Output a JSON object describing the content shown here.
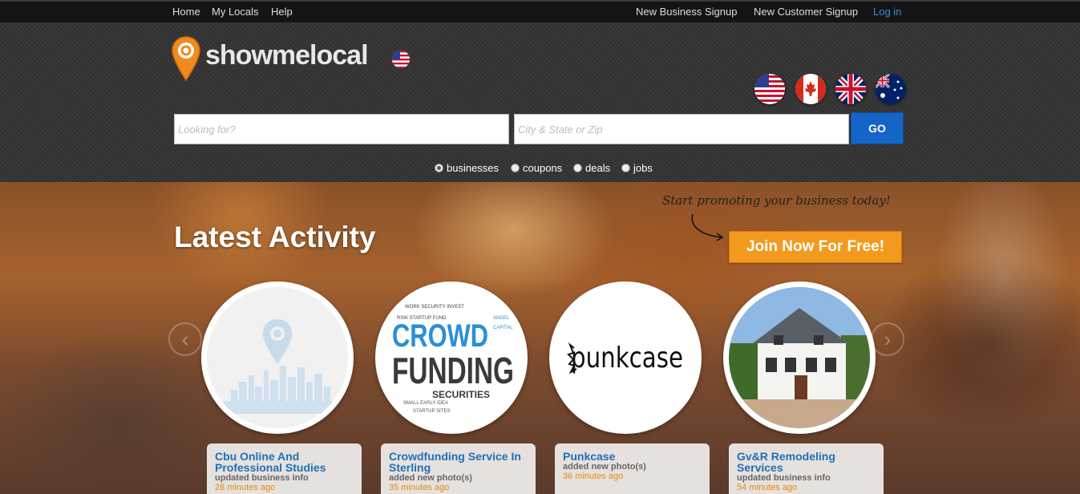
{
  "topnav": {
    "home": "Home",
    "my_locals": "My Locals",
    "help": "Help",
    "new_business_signup": "New Business Signup",
    "new_customer_signup": "New Customer Signup",
    "login": "Log in"
  },
  "header": {
    "logo_text": "showmelocal",
    "flags": [
      "united-states-flag",
      "canada-flag",
      "united-kingdom-flag",
      "australia-flag"
    ]
  },
  "search": {
    "looking_for_placeholder": "Looking for?",
    "location_placeholder": "City & State or Zip",
    "go_label": "GO",
    "options": [
      {
        "label": "businesses",
        "checked": true
      },
      {
        "label": "coupons",
        "checked": false
      },
      {
        "label": "deals",
        "checked": false
      },
      {
        "label": "jobs",
        "checked": false
      }
    ]
  },
  "hero": {
    "title": "Latest Activity",
    "promo_text": "Start promoting your business today!",
    "join_label": "Join Now For Free!",
    "prev_arrow": "‹",
    "next_arrow": "›"
  },
  "activities": [
    {
      "name": "Cbu Online And Professional Studies",
      "action": "updated business info",
      "time": "28 minutes ago",
      "image": "map-pin-city-skyline"
    },
    {
      "name": "Crowdfunding Service In Sterling",
      "action": "added new photo(s)",
      "time": "35 minutes ago",
      "image": "crowdfunding-word-cloud"
    },
    {
      "name": "Punkcase",
      "action": "added new photo(s)",
      "time": "36 minutes ago",
      "image": "punkcase-logo",
      "logo_text": "punkcase"
    },
    {
      "name": "Gv&R Remodeling Services",
      "action": "updated business info",
      "time": "54 minutes ago",
      "image": "white-house-photo"
    }
  ],
  "colors": {
    "accent_blue": "#1565c8",
    "join_orange": "#f39a1e",
    "link_blue": "#1f6fb7",
    "time_orange": "#e28a12"
  }
}
